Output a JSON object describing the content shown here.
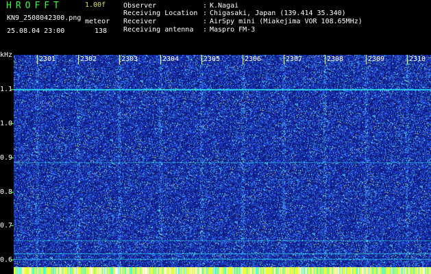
{
  "header": {
    "logo": "HROFFT",
    "version": "1.00f",
    "filename": "KN9_2508042300.png",
    "mode": "meteor",
    "datetime": "25.08.04 23:00",
    "count": "138",
    "info": [
      {
        "label": "Observer",
        "value": "K.Nagai"
      },
      {
        "label": "Receiving Location",
        "value": "Chigasaki, Japan (139.414 35.340)"
      },
      {
        "label": "Receiver",
        "value": "AirSpy mini (Miakejima VOR 108.65MHz)"
      },
      {
        "label": "Receiving antenna",
        "value": "Maspro FM-3"
      }
    ]
  },
  "axis": {
    "y_unit": "kHz",
    "y_ticks": [
      "1.1",
      "1.0",
      "0.9",
      "0.8",
      "0.7",
      "0.6"
    ],
    "x_ticks": [
      "2301",
      "2302",
      "2303",
      "2304",
      "2305",
      "2306",
      "2307",
      "2308",
      "2309",
      "2310"
    ]
  },
  "colors": {
    "background": "#0b1a7a",
    "noise": "#3a5cff",
    "signal": "#2ef0ff",
    "text_green": "#33ff33",
    "text_white": "#ffffff"
  }
}
